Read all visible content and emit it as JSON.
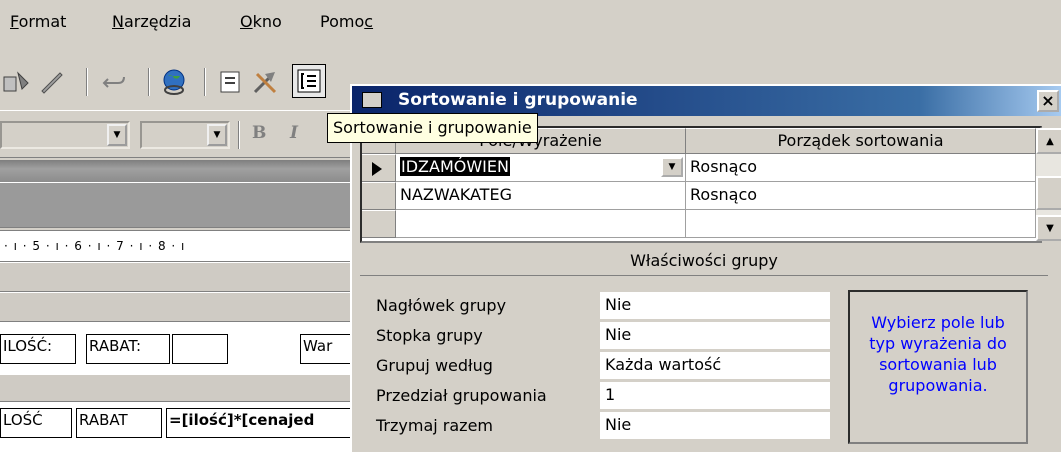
{
  "menu": {
    "items": [
      {
        "label": "Format",
        "accel": "F"
      },
      {
        "label": "Narzędzia",
        "accel": "N"
      },
      {
        "label": "Okno",
        "accel": "O"
      },
      {
        "label": "Pomoc",
        "accel": "c"
      }
    ]
  },
  "toolbar": {
    "icons": [
      "format-painter-icon",
      "undo-icon",
      "hyperlink-globe-icon",
      "properties-icon",
      "build-tools-icon",
      "sorting-grouping-icon"
    ]
  },
  "format_bar": {
    "bold_label": "B",
    "italic_label": "I"
  },
  "tooltip": {
    "text": "Sortowanie i grupowanie"
  },
  "ruler": {
    "text": "· ı · 5 · ı · 6 · ı · 7 · ı · 8 · ı"
  },
  "report": {
    "header_labels": [
      "ILOŚĆ:",
      "RABAT:",
      "",
      "War"
    ],
    "detail_fields": [
      "LOŚĆ",
      "RABAT",
      "=[ilość]*[cenajed"
    ]
  },
  "dialog": {
    "title": "Sortowanie i grupowanie",
    "close_label": "×",
    "columns": {
      "field": "Pole/Wyrażenie",
      "order": "Porządek sortowania"
    },
    "rows": [
      {
        "field": "IDZAMÓWIEN",
        "order": "Rosnąco"
      },
      {
        "field": "NAZWAKATEG",
        "order": "Rosnąco"
      },
      {
        "field": "",
        "order": ""
      }
    ],
    "group_props_title": "Właściwości grupy",
    "properties": [
      {
        "label": "Nagłówek grupy",
        "value": "Nie"
      },
      {
        "label": "Stopka grupy",
        "value": "Nie"
      },
      {
        "label": "Grupuj według",
        "value": "Każda wartość"
      },
      {
        "label": "Przedział grupowania",
        "value": "1"
      },
      {
        "label": "Trzymaj razem",
        "value": "Nie"
      }
    ],
    "help_text": "Wybierz pole lub typ wyrażenia do sortowania lub grupowania."
  },
  "colors": {
    "title_bar": "#0a246a",
    "tooltip_bg": "#ffffe1",
    "help_text": "#0000ff",
    "window_face": "#d4d0c8"
  }
}
